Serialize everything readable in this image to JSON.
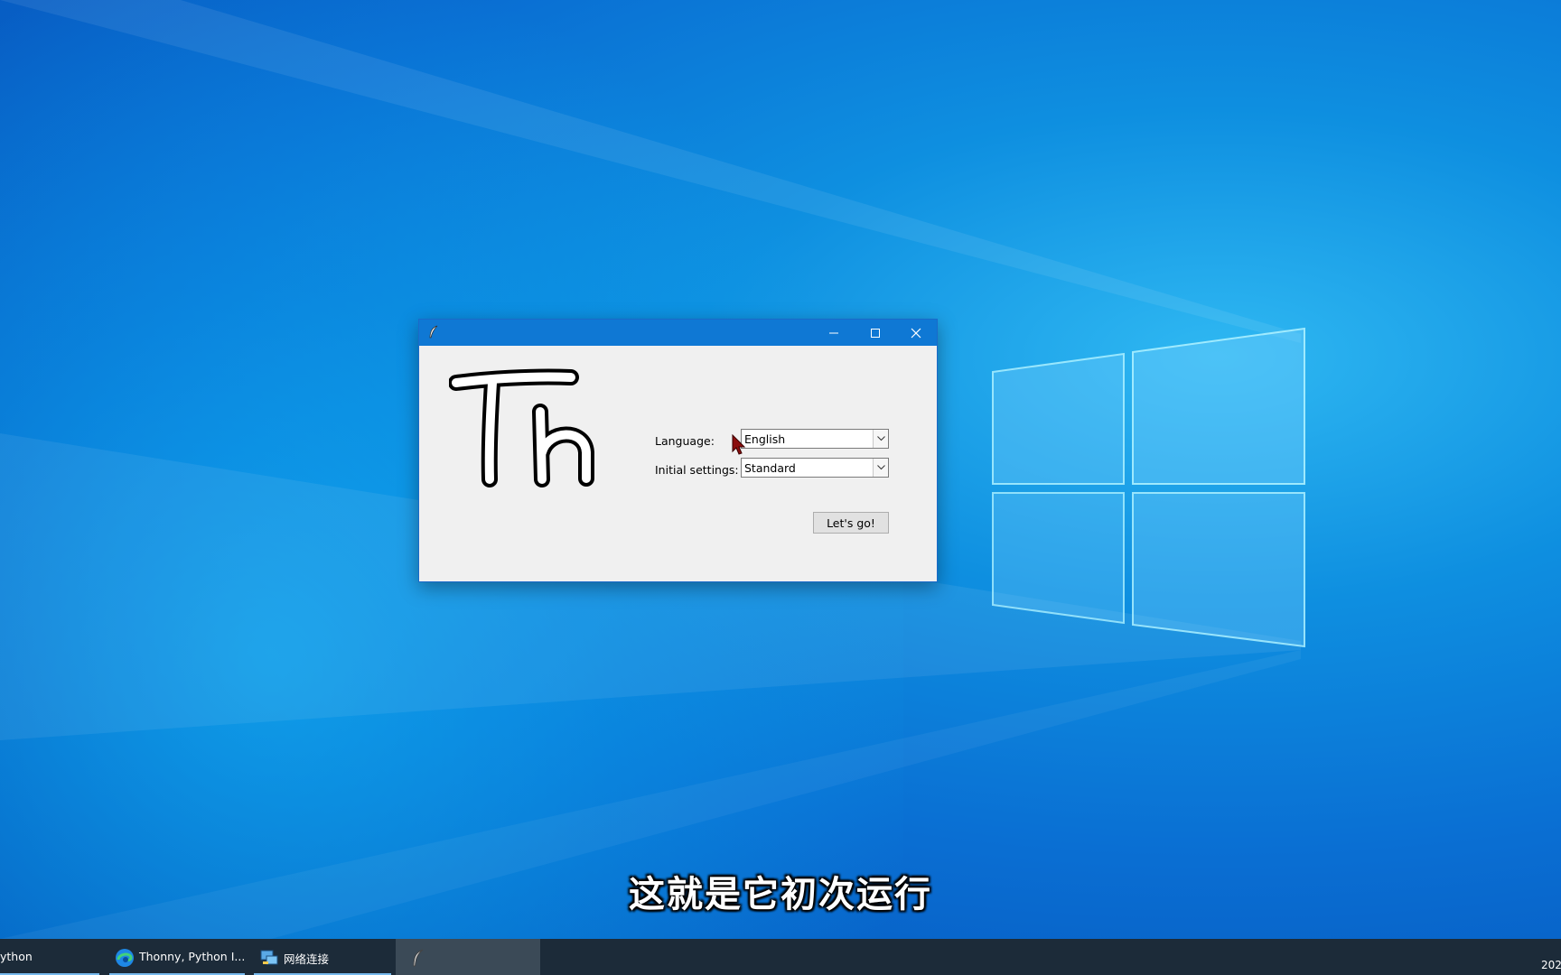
{
  "dialog": {
    "title": "",
    "logo_text": "Th",
    "language_label": "Language:",
    "language_value": "English",
    "initial_settings_label": "Initial settings:",
    "initial_settings_value": "Standard",
    "go_button": "Let's go!"
  },
  "subtitle": "这就是它初次运行",
  "taskbar": {
    "items": [
      {
        "label": "ython",
        "icon": "python-icon"
      },
      {
        "label": "Thonny, Python I...",
        "icon": "edge-browser-icon"
      },
      {
        "label": "网络连接",
        "icon": "network-connections-icon"
      },
      {
        "label": "",
        "icon": "feather-icon",
        "active": true
      }
    ],
    "clock_partial": "202"
  },
  "colors": {
    "titlebar": "#0f78d4",
    "taskbar": "#1c2b39",
    "dialog_bg": "#f0f0f0",
    "accent_underline": "#76b9ed"
  }
}
